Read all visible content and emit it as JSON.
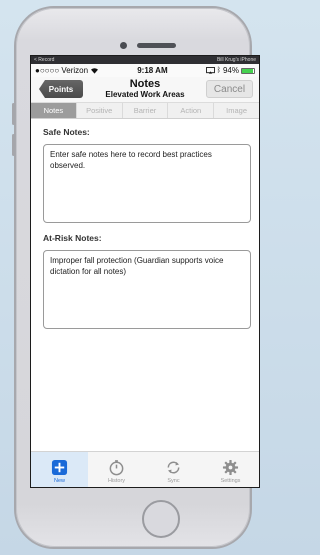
{
  "top_strip": {
    "left": "< Record",
    "right": "Bill Krug's iPhone"
  },
  "status": {
    "carrier": "●○○○○ Verizon",
    "time": "9:18 AM",
    "battery": "94%"
  },
  "navbar": {
    "back_label": "Points",
    "title": "Notes",
    "subtitle": "Elevated Work Areas",
    "cancel_label": "Cancel"
  },
  "tabs": [
    "Notes",
    "Positive",
    "Barrier",
    "Action",
    "Image"
  ],
  "safe": {
    "label": "Safe Notes:",
    "value": "Enter safe notes here to record best practices observed."
  },
  "atrisk": {
    "label": "At-Risk Notes:",
    "value": "Improper fall protection (Guardian supports voice dictation for all notes)"
  },
  "tabbar": {
    "items": [
      {
        "label": "New",
        "icon": "plus-icon"
      },
      {
        "label": "History",
        "icon": "stopwatch-icon"
      },
      {
        "label": "Sync",
        "icon": "sync-icon"
      },
      {
        "label": "Settings",
        "icon": "gear-icon"
      }
    ]
  },
  "colors": {
    "accent": "#1a6ad8",
    "active_segment": "#9c9c9c",
    "battery": "#45d14f"
  }
}
